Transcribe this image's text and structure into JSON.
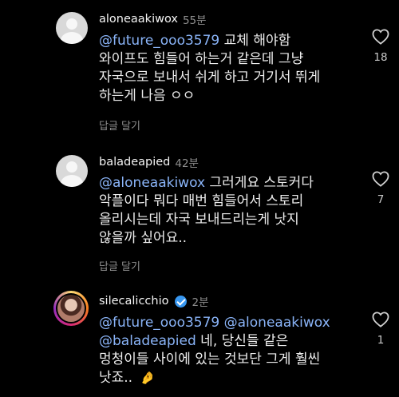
{
  "comments": [
    {
      "username": "aloneaakiwox",
      "time": "55분",
      "lines": [
        {
          "mention": "@future_ooo3579",
          "text": " 교체 해야함"
        },
        {
          "mention": "",
          "text": "와이프도 힘들어 하는거 같은데 그냥"
        },
        {
          "mention": "",
          "text": "자국으로 보내서 쉬게 하고 거기서 뛰게"
        },
        {
          "mention": "",
          "text": "하는게 나음 ㅇㅇ"
        }
      ],
      "reply_label": "답글 달기",
      "likes": "18",
      "avatar": "default-avatar"
    },
    {
      "username": "baladeapied",
      "time": "42분",
      "lines": [
        {
          "mention": "@aloneaakiwox",
          "text": " 그러게요 스토커다"
        },
        {
          "mention": "",
          "text": "악플이다 뭐다 매번 힘들어서 스토리"
        },
        {
          "mention": "",
          "text": "올리시는데 자국 보내드리는게 낫지"
        },
        {
          "mention": "",
          "text": "않을까 싶어요.."
        }
      ],
      "reply_label": "답글 달기",
      "likes": "7",
      "avatar": "default-avatar"
    },
    {
      "username": "silecalicchio",
      "time": "2분",
      "verified": true,
      "lines": [
        {
          "mention": "@future_ooo3579 @aloneaakiwox",
          "text": ""
        },
        {
          "mention": "@baladeapied",
          "text": " 네, 당신들 같은"
        },
        {
          "mention": "",
          "text": "멍청이들 사이에 있는 것보단 그게 훨씬"
        },
        {
          "mention": "",
          "text": "낫죠.. "
        }
      ],
      "emoji": "🤌",
      "likes": "1",
      "avatar": "story-avatar-photo"
    }
  ],
  "colors": {
    "background": "#000000",
    "mention": "#8ab4f8",
    "muted": "#8e8e8e",
    "verified": "#3897f0"
  }
}
